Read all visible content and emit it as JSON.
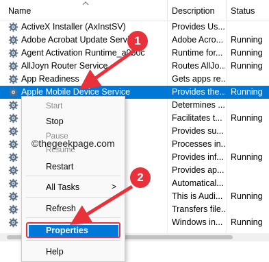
{
  "header": {
    "name_label": "Name",
    "description_label": "Description",
    "status_label": "Status"
  },
  "services": [
    {
      "name": "ActiveX Installer (AxInstSV)",
      "description": "Provides Us...",
      "status": ""
    },
    {
      "name": "Adobe Acrobat Update Service",
      "description": "Adobe Acro...",
      "status": "Running"
    },
    {
      "name": "Agent Activation Runtime_a0b0c",
      "description": "Runtime for...",
      "status": "Running"
    },
    {
      "name": "AllJoyn Router Service",
      "description": "Routes AllJo...",
      "status": "Running"
    },
    {
      "name": "App Readiness",
      "description": "Gets apps re...",
      "status": ""
    },
    {
      "name": "Apple Mobile Device Service",
      "description": "Provides the...",
      "status": "Running",
      "selected": true
    },
    {
      "name": "",
      "description": "Determines ...",
      "status": ""
    },
    {
      "name": "",
      "description": "Facilitates t...",
      "status": "Running"
    },
    {
      "name": "rvice",
      "description": "Provides su...",
      "status": ""
    },
    {
      "name": "",
      "description": "Processes in...",
      "status": ""
    },
    {
      "name": "ppXSVC)",
      "description": "Provides inf...",
      "status": "Running"
    },
    {
      "name": "",
      "description": "Provides ap...",
      "status": ""
    },
    {
      "name": "",
      "description": "Automatical...",
      "status": ""
    },
    {
      "name": "",
      "description": "This is Audi...",
      "status": "Running"
    },
    {
      "name": "fer Service",
      "description": "Transfers file...",
      "status": ""
    },
    {
      "name": "Service",
      "description": "Windows in...",
      "status": "Running"
    }
  ],
  "context_menu": {
    "start": "Start",
    "stop": "Stop",
    "pause": "Pause",
    "resume": "Resume",
    "restart": "Restart",
    "all_tasks": "All Tasks",
    "submenu_arrow": ">",
    "refresh": "Refresh",
    "properties": "Properties",
    "help": "Help"
  },
  "annotations": {
    "step1": "1",
    "step2": "2",
    "watermark": "©thegeekpage.com",
    "accent_color": "#e8313a"
  },
  "selection_color": "#0078d7"
}
